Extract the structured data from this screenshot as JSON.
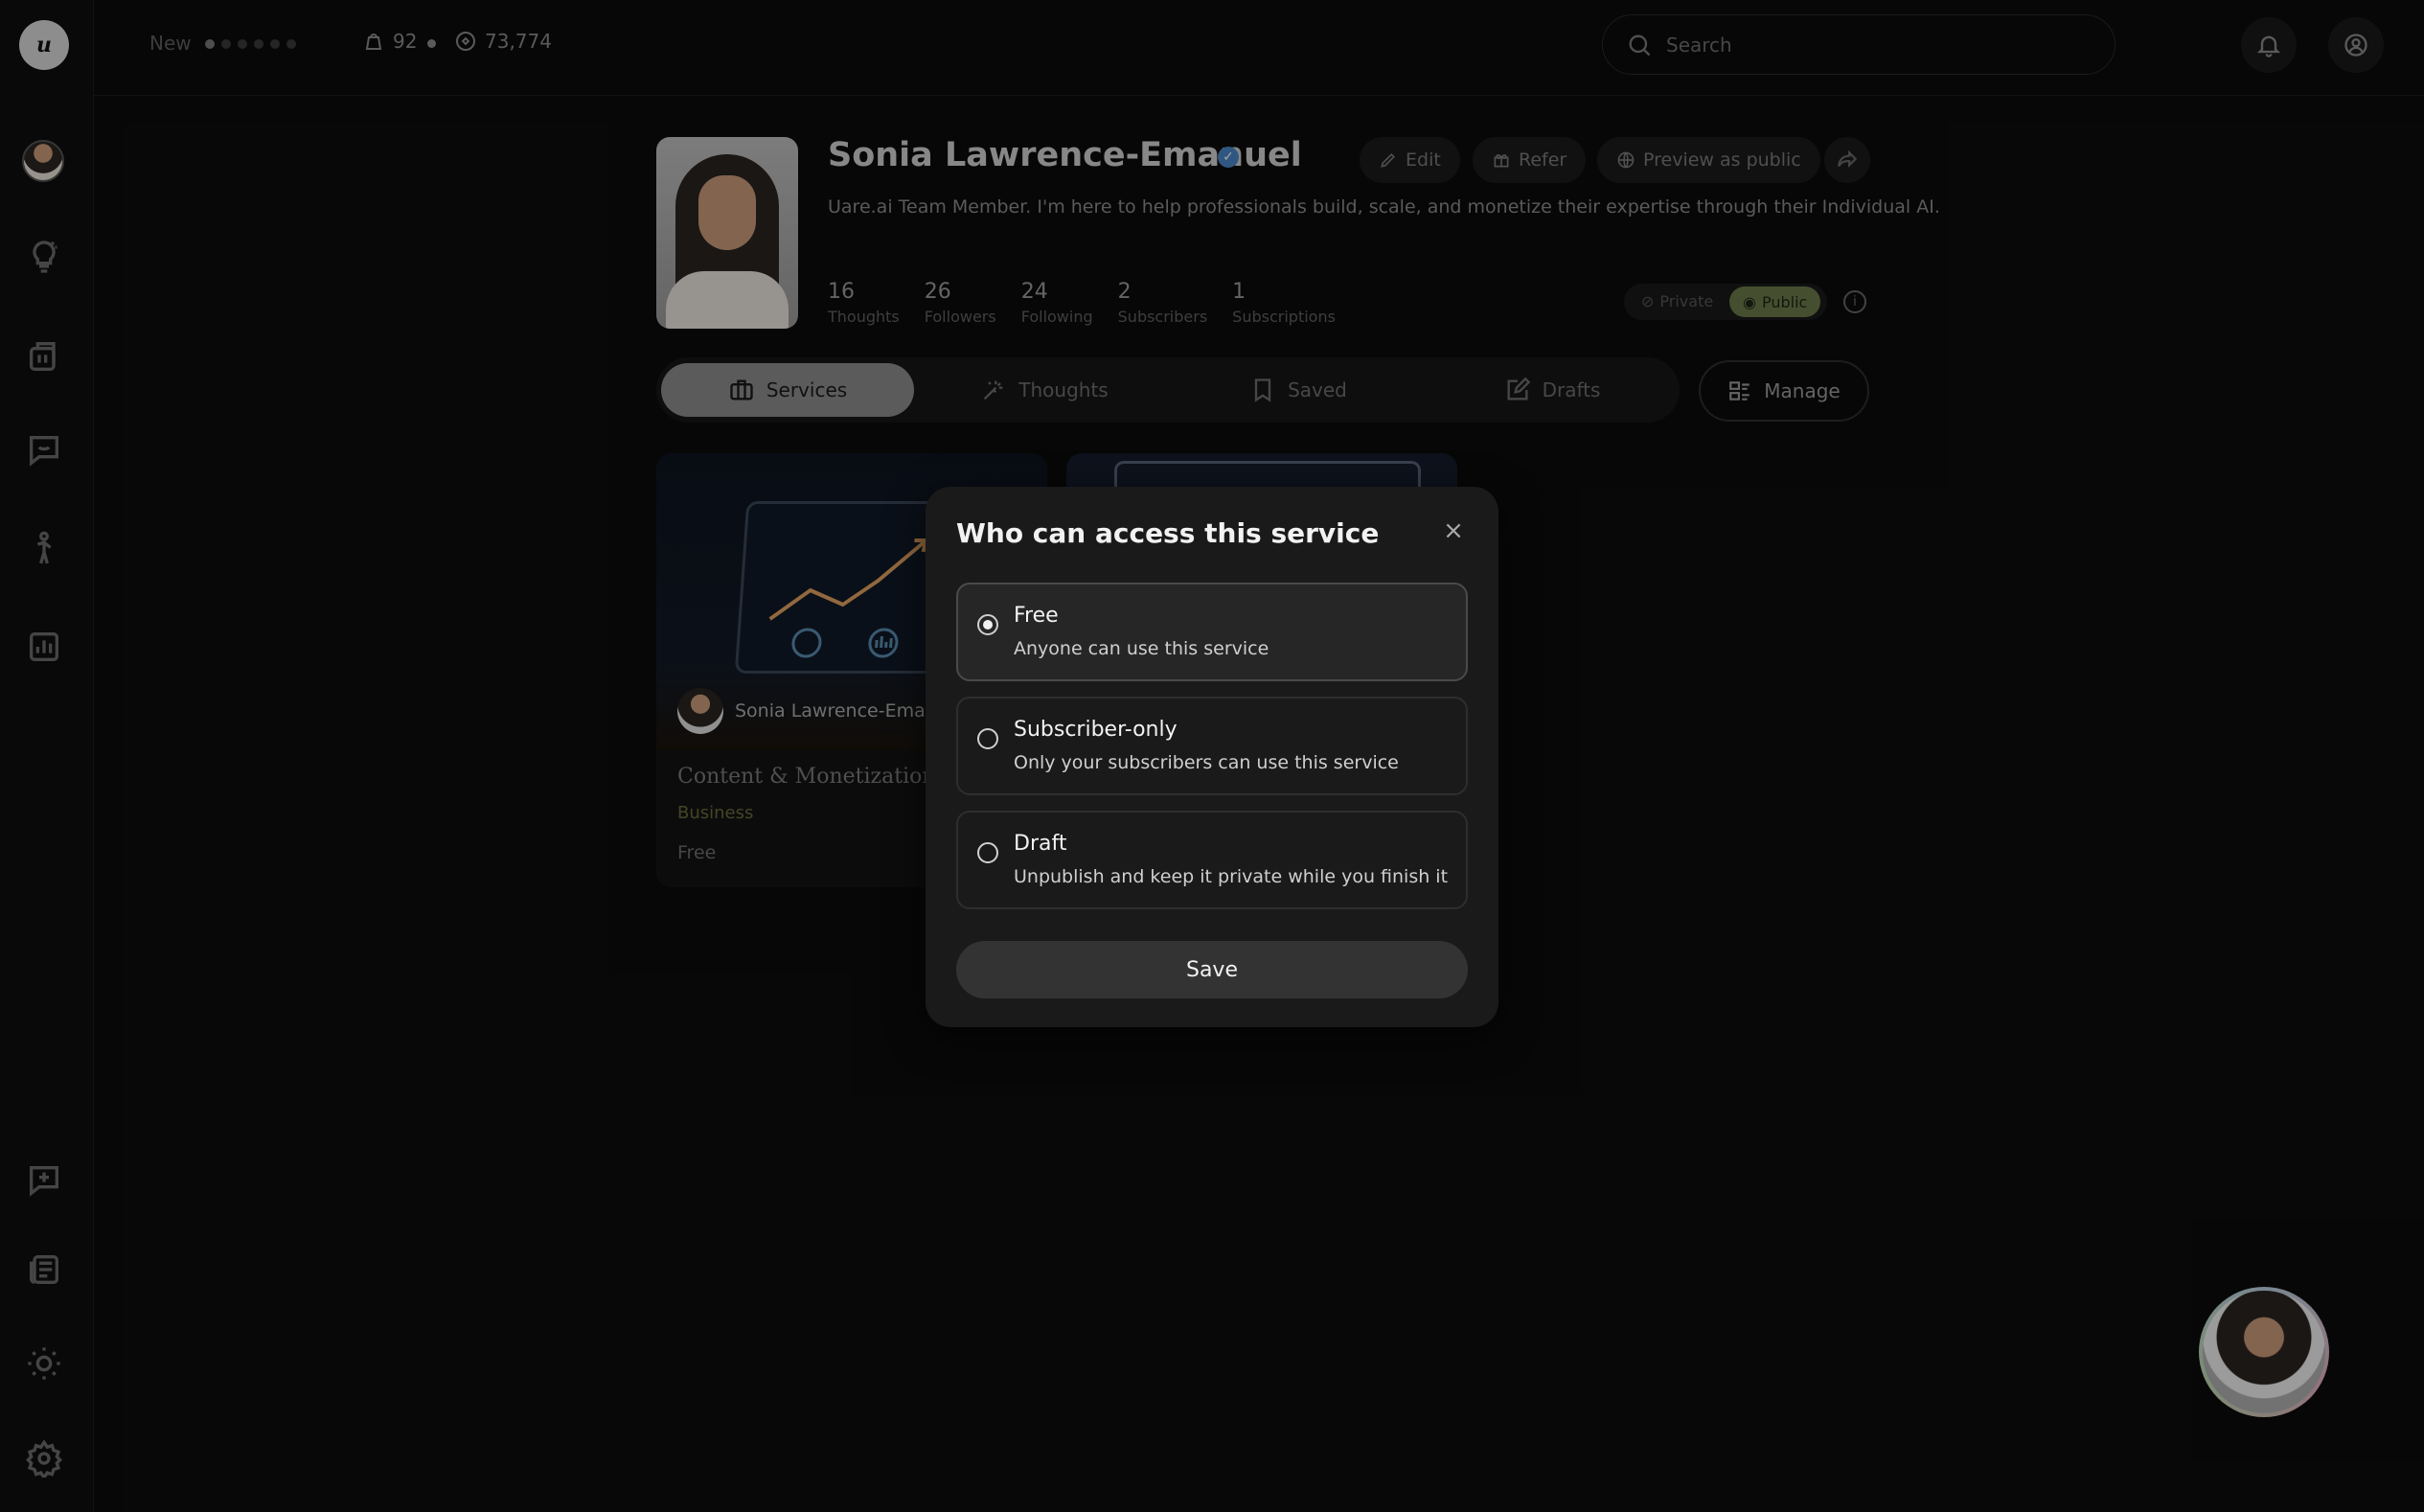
{
  "topbar": {
    "new_label": "New",
    "tokens_count": "92",
    "credits_count": "73,774",
    "search_placeholder": "Search"
  },
  "profile": {
    "name": "Sonia Lawrence-Emanuel",
    "bio": "Uare.ai Team Member. I'm here to help professionals build, scale, and monetize their expertise through their Individual AI.",
    "actions": {
      "edit": "Edit",
      "refer": "Refer",
      "preview": "Preview as public"
    },
    "stats": [
      {
        "value": "16",
        "label": "Thoughts"
      },
      {
        "value": "26",
        "label": "Followers"
      },
      {
        "value": "24",
        "label": "Following"
      },
      {
        "value": "2",
        "label": "Subscribers"
      },
      {
        "value": "1",
        "label": "Subscriptions"
      }
    ],
    "visibility": {
      "private": "Private",
      "public": "Public"
    }
  },
  "tabs": [
    {
      "label": "Services",
      "active": true
    },
    {
      "label": "Thoughts"
    },
    {
      "label": "Saved"
    },
    {
      "label": "Drafts"
    }
  ],
  "manage_label": "Manage",
  "card": {
    "author": "Sonia Lawrence-Eman",
    "title": "Content & Monetization",
    "category": "Business",
    "price": "Free"
  },
  "modal": {
    "title": "Who can access this service",
    "close": "×",
    "options": [
      {
        "title": "Free",
        "description": "Anyone can use this service",
        "selected": true
      },
      {
        "title": "Subscriber-only",
        "description": "Only your subscribers can use this service",
        "selected": false
      },
      {
        "title": "Draft",
        "description": "Unpublish and keep it private while you finish it",
        "selected": false
      }
    ],
    "save_label": "Save"
  },
  "colors": {
    "accent_public": "#6b7a4a",
    "verified": "#4a86c7"
  }
}
